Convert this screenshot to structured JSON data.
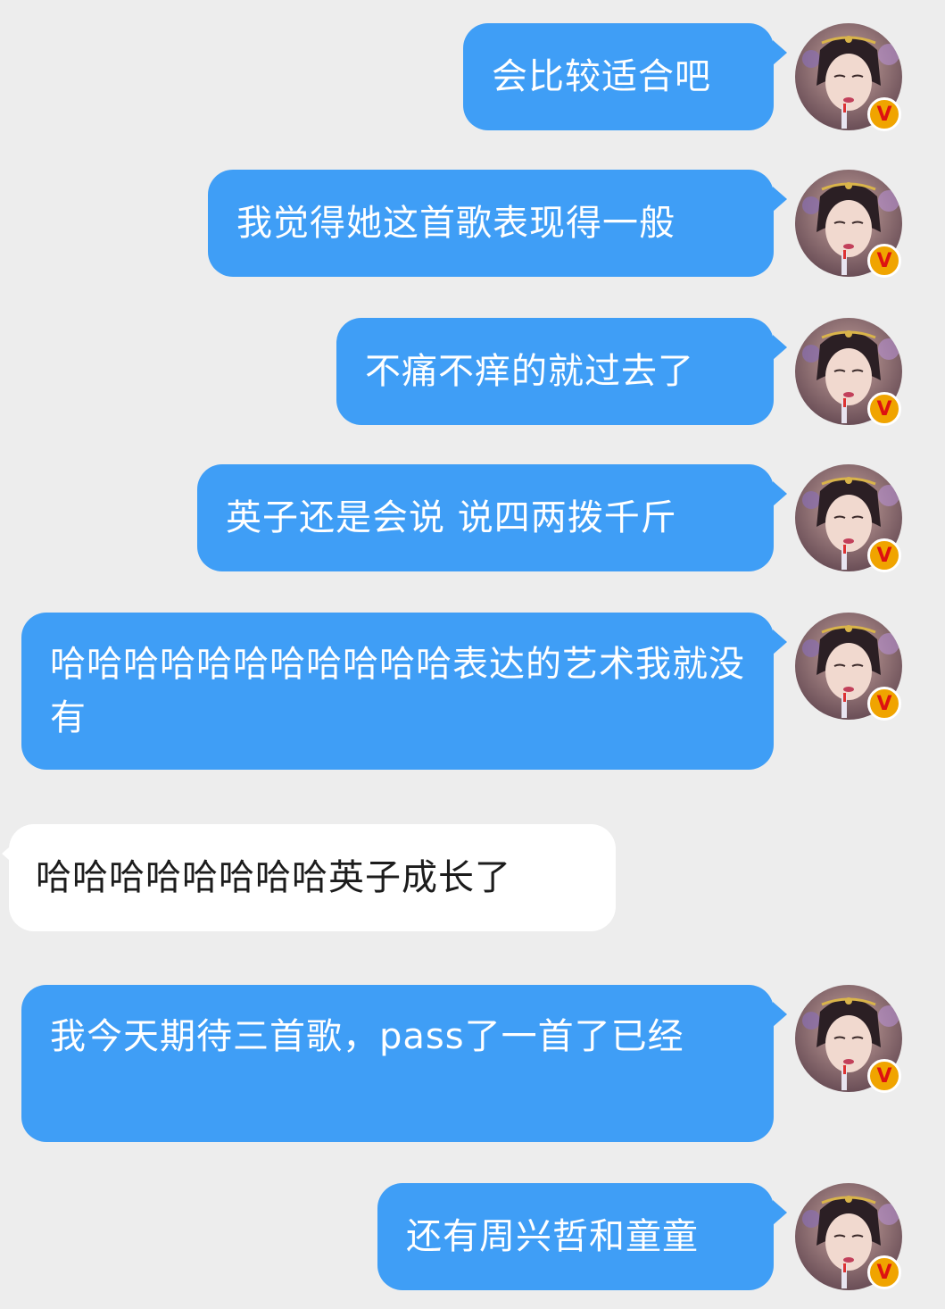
{
  "messages": [
    {
      "side": "out",
      "text": "会比较适合吧"
    },
    {
      "side": "out",
      "text": "我觉得她这首歌表现得一般"
    },
    {
      "side": "out",
      "text": "不痛不痒的就过去了"
    },
    {
      "side": "out",
      "text": "英子还是会说 说四两拨千斤"
    },
    {
      "side": "out",
      "text": "哈哈哈哈哈哈哈哈哈哈哈表达的艺术我就没有"
    },
    {
      "side": "in",
      "text": "哈哈哈哈哈哈哈哈英子成长了"
    },
    {
      "side": "out",
      "text": "我今天期待三首歌，pass了一首了已经"
    },
    {
      "side": "out",
      "text": "还有周兴哲和童童"
    }
  ],
  "badge_label": "V",
  "watermark": "",
  "colors": {
    "outgoing_bubble": "#3f9ef6",
    "incoming_bubble": "#ffffff",
    "background": "#ededed",
    "badge": "#f0a400"
  }
}
